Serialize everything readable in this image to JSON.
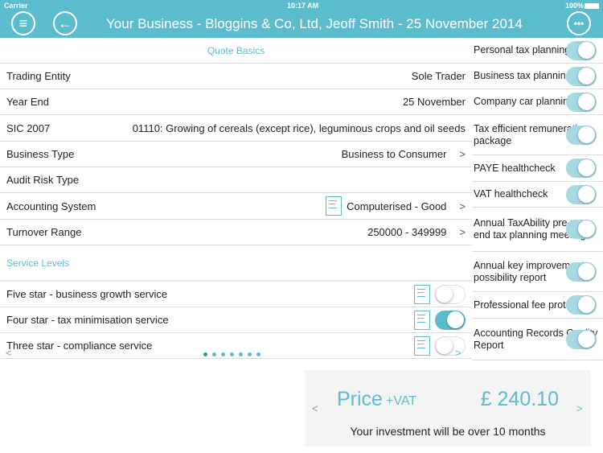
{
  "status": {
    "carrier": "Carrier",
    "time": "10:17 AM",
    "battery": "100%"
  },
  "header": {
    "title": "Your Business - Bloggins & Co, Ltd, Jeoff Smith - 25 November 2014",
    "menu_icon": "hamburger-icon",
    "back_icon": "arrow-left-icon",
    "more_icon": "ellipsis-icon",
    "color": "#5bbccd"
  },
  "quote_basics": {
    "title": "Quote Basics",
    "rows": [
      {
        "label": "Trading Entity",
        "value": "Sole Trader"
      },
      {
        "label": "Year End",
        "value": "25 November"
      },
      {
        "label": "SIC 2007",
        "value": "01110: Growing of cereals (except rice), leguminous crops and oil seeds"
      },
      {
        "label": "Business Type",
        "value": "Business to Consumer",
        "chevron": ">"
      },
      {
        "label": "Audit Risk Type",
        "value": ""
      },
      {
        "label": "Accounting System",
        "value": "Computerised - Good",
        "chevron": ">",
        "doc": true
      },
      {
        "label": "Turnover Range",
        "value": "250000 - 349999",
        "chevron": ">"
      }
    ]
  },
  "service_levels": {
    "title": "Service Levels",
    "items": [
      {
        "label": "Five star - business growth service",
        "on": false
      },
      {
        "label": "Four star - tax minimisation service",
        "on": true
      },
      {
        "label": "Three star - compliance service",
        "on": false
      }
    ]
  },
  "pager": {
    "prev": "<",
    "next": ">",
    "pages": 7,
    "current": 1
  },
  "options": [
    {
      "label": "Personal tax planning",
      "on": true
    },
    {
      "label": "Business tax planning",
      "on": true
    },
    {
      "label": "Company car planning",
      "on": true
    },
    {
      "label": "Tax efficient remuneration package",
      "on": true
    },
    {
      "label": "PAYE healthcheck",
      "on": true
    },
    {
      "label": "VAT healthcheck",
      "on": true
    },
    {
      "label": "Annual TaxAbility pre-year end tax planning meeting",
      "on": true
    },
    {
      "label": "Annual key improvement possibility report",
      "on": true
    },
    {
      "label": "Professional fee protection",
      "on": true
    },
    {
      "label": "Accounting Records Quality Report",
      "on": true
    }
  ],
  "price": {
    "label": "Price",
    "suffix": "+VAT",
    "amount": "£ 240.10",
    "note": "Your investment will be over 10 months",
    "prev": "<",
    "next": ">"
  }
}
